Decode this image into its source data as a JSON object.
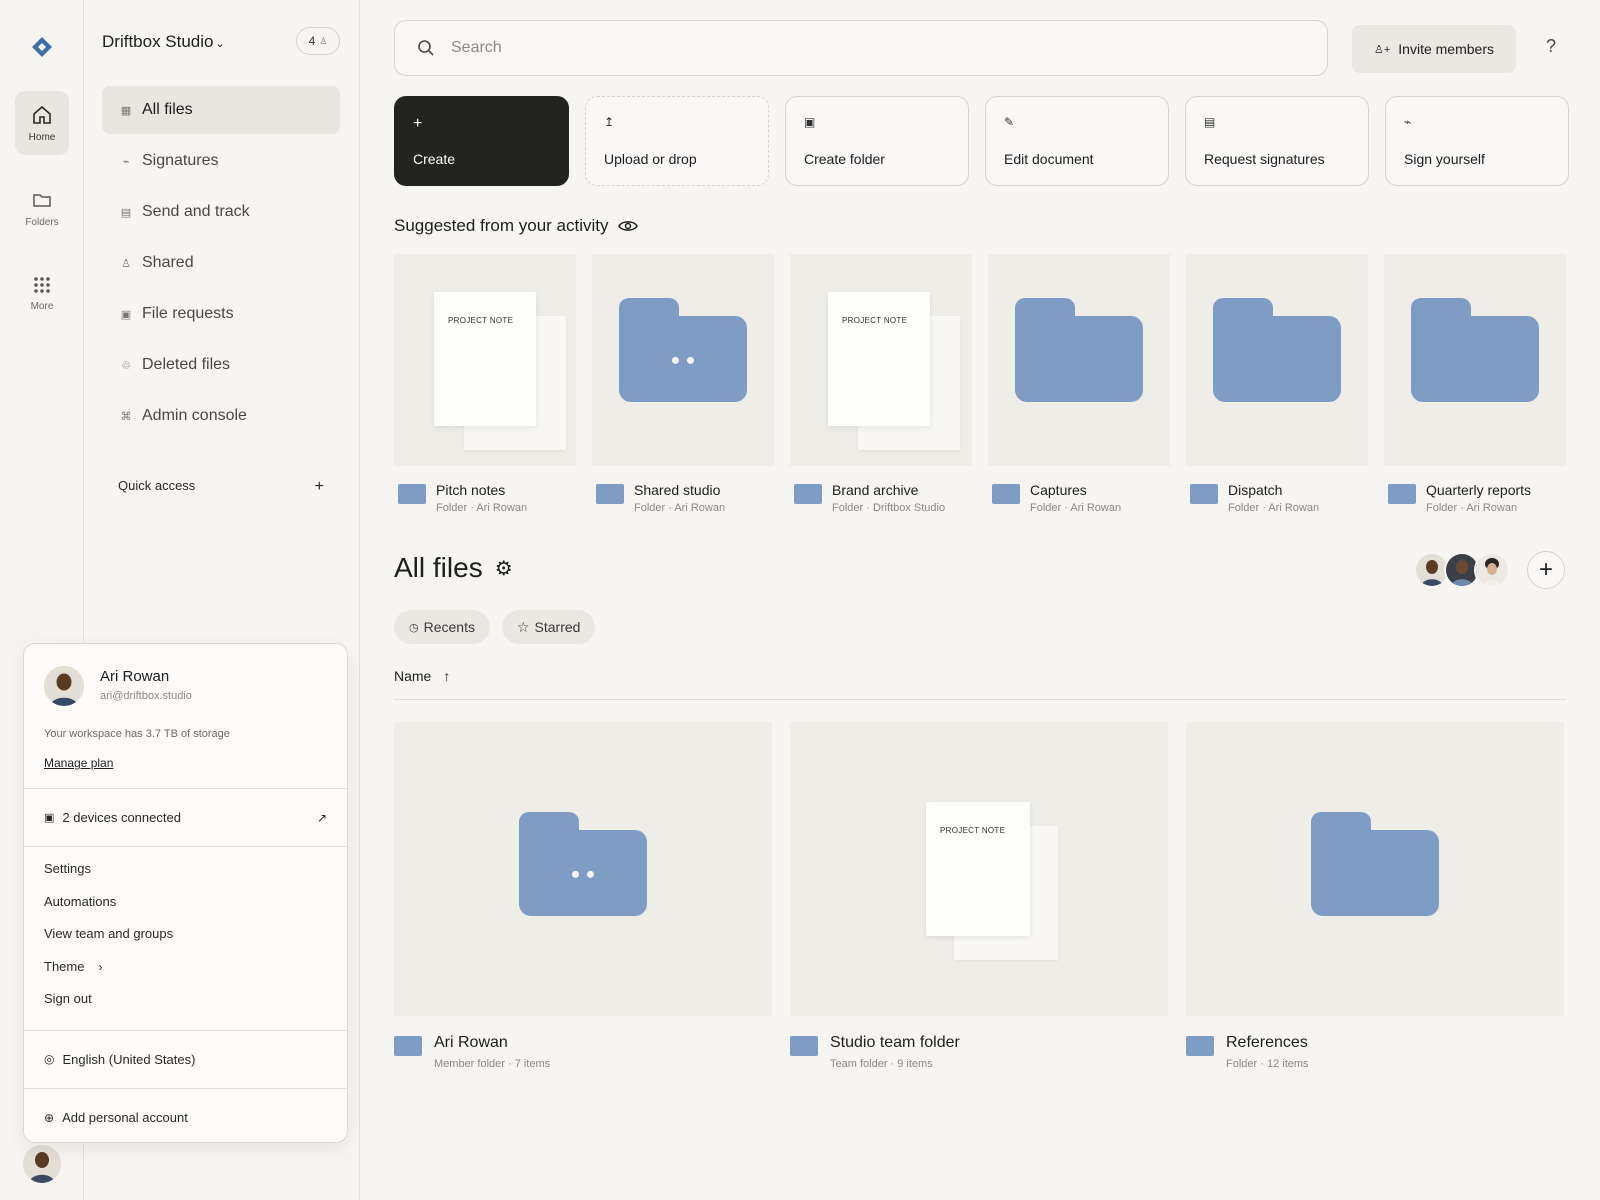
{
  "rail": {
    "items": [
      {
        "label": "Home",
        "icon": "home-icon"
      },
      {
        "label": "Folders",
        "icon": "folder-icon"
      },
      {
        "label": "More",
        "icon": "grid-icon"
      }
    ]
  },
  "sidebar": {
    "workspace_name": "Driftbox Studio",
    "member_count": "4",
    "nav": [
      {
        "label": "All files",
        "icon": "▦"
      },
      {
        "label": "Signatures",
        "icon": "⌁"
      },
      {
        "label": "Send and track",
        "icon": "▤"
      },
      {
        "label": "Shared",
        "icon": "♙"
      },
      {
        "label": "File requests",
        "icon": "▣"
      },
      {
        "label": "Deleted files",
        "icon": "♲"
      },
      {
        "label": "Admin console",
        "icon": "⌘"
      }
    ],
    "quick_access_label": "Quick access",
    "quick_access_add": "+"
  },
  "search": {
    "placeholder": "Search"
  },
  "header": {
    "invite_label": "Invite members",
    "help_label": "?"
  },
  "actions": [
    {
      "label": "Create",
      "icon": "+"
    },
    {
      "label": "Upload or drop",
      "icon": "↥"
    },
    {
      "label": "Create folder",
      "icon": "▣"
    },
    {
      "label": "Edit document",
      "icon": "✎"
    },
    {
      "label": "Request signatures",
      "icon": "▤"
    },
    {
      "label": "Sign yourself",
      "icon": "⌁"
    }
  ],
  "suggested": {
    "title": "Suggested from your activity",
    "doc_label": "PROJECT NOTE",
    "items": [
      {
        "name": "Pitch notes",
        "meta": "Folder · Ari Rowan",
        "thumb": "doc"
      },
      {
        "name": "Shared studio",
        "meta": "Folder · Ari Rowan",
        "thumb": "folder-eyes"
      },
      {
        "name": "Brand archive",
        "meta": "Folder · Driftbox Studio",
        "thumb": "doc"
      },
      {
        "name": "Captures",
        "meta": "Folder · Ari Rowan",
        "thumb": "folder"
      },
      {
        "name": "Dispatch",
        "meta": "Folder · Ari Rowan",
        "thumb": "folder"
      },
      {
        "name": "Quarterly reports",
        "meta": "Folder · Ari Rowan",
        "thumb": "folder"
      }
    ]
  },
  "all_files": {
    "title": "All files",
    "chips": [
      {
        "label": "Recents",
        "icon": "◷"
      },
      {
        "label": "Starred",
        "icon": "☆"
      }
    ],
    "sort_label": "Name",
    "sort_icon": "↑",
    "add_label": "+",
    "items": [
      {
        "name": "Ari Rowan",
        "meta": "Member folder · 7 items",
        "thumb": "folder-eyes"
      },
      {
        "name": "Studio team folder",
        "meta": "Team folder · 9 items",
        "thumb": "doc"
      },
      {
        "name": "References",
        "meta": "Folder · 12 items",
        "thumb": "folder"
      }
    ]
  },
  "account": {
    "name": "Ari Rowan",
    "email": "ari@driftbox.studio",
    "storage_text": "Your workspace has 3.7 TB of storage",
    "manage_label": "Manage plan",
    "devices_label": "2 devices connected",
    "menu": [
      "Settings",
      "Automations",
      "View team and groups",
      "Theme",
      "Sign out"
    ],
    "theme_arrow": "›",
    "language_label": "English (United States)",
    "add_account_label": "Add personal account"
  },
  "colors": {
    "accent": "#7f9cc4",
    "primary_button": "#232421",
    "logo": "#3f6fa8"
  }
}
